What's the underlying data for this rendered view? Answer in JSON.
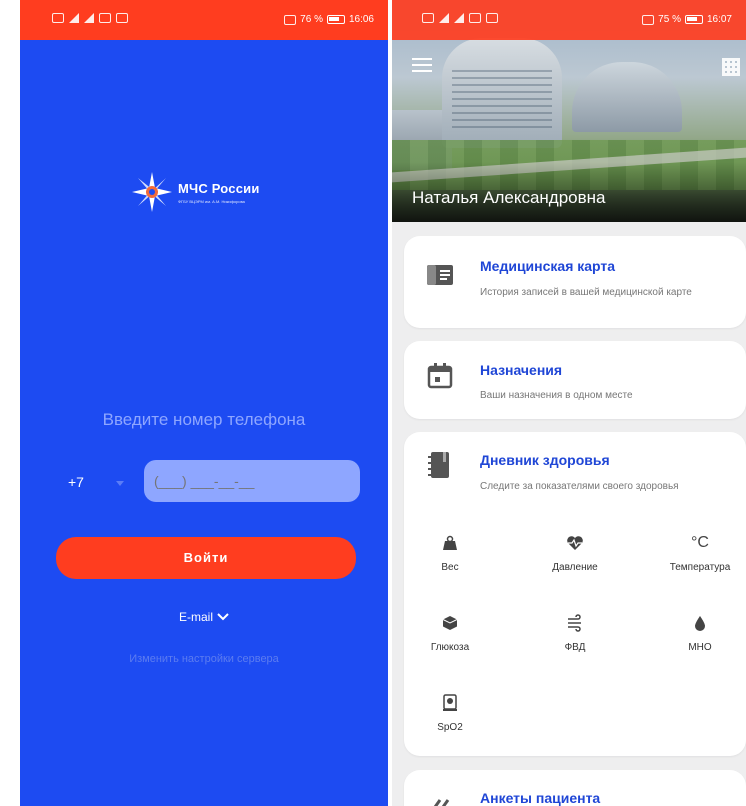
{
  "left_screen": {
    "status": {
      "battery": "76 %",
      "time": "16:06"
    },
    "logo": {
      "title": "МЧС России",
      "subtitle": "ФГБУ ВЦЭРМ им. А.М. Никифорова"
    },
    "phone_label": "Введите номер телефона",
    "country_code": "+7",
    "phone_placeholder": "(___) ___-__-__",
    "login_button": "Войти",
    "email_toggle": "E-mail",
    "server_settings_link": "Изменить настройки сервера",
    "colors": {
      "background": "#1d4bf2",
      "accent": "#ff3d1f"
    }
  },
  "right_screen": {
    "status": {
      "battery": "75 %",
      "time": "16:07"
    },
    "user_name": "Наталья Александровна",
    "cards": {
      "medical_card": {
        "title": "Медицинская карта",
        "description": "История записей в вашей медицинской карте",
        "icon": "id-card-icon"
      },
      "appointments": {
        "title": "Назначения",
        "description": "Ваши назначения в одном месте",
        "icon": "calendar-icon"
      },
      "health_diary": {
        "title": "Дневник здоровья",
        "description": "Следите за показателями своего здоровья",
        "icon": "notebook-icon"
      },
      "questionnaires": {
        "title": "Анкеты пациента",
        "icon": "pencil-icon"
      }
    },
    "metrics": [
      {
        "label": "Вес",
        "icon": "weight-icon"
      },
      {
        "label": "Давление",
        "icon": "heartbeat-icon"
      },
      {
        "label": "Температура",
        "icon": "celsius-icon",
        "glyph": "°C"
      },
      {
        "label": "Глюкоза",
        "icon": "cube-icon"
      },
      {
        "label": "ФВД",
        "icon": "wind-icon"
      },
      {
        "label": "МНО",
        "icon": "drop-icon"
      },
      {
        "label": "SpO2",
        "icon": "pulse-oximeter-icon"
      }
    ],
    "colors": {
      "title": "#1f46d6",
      "background": "#eeeeef"
    }
  }
}
